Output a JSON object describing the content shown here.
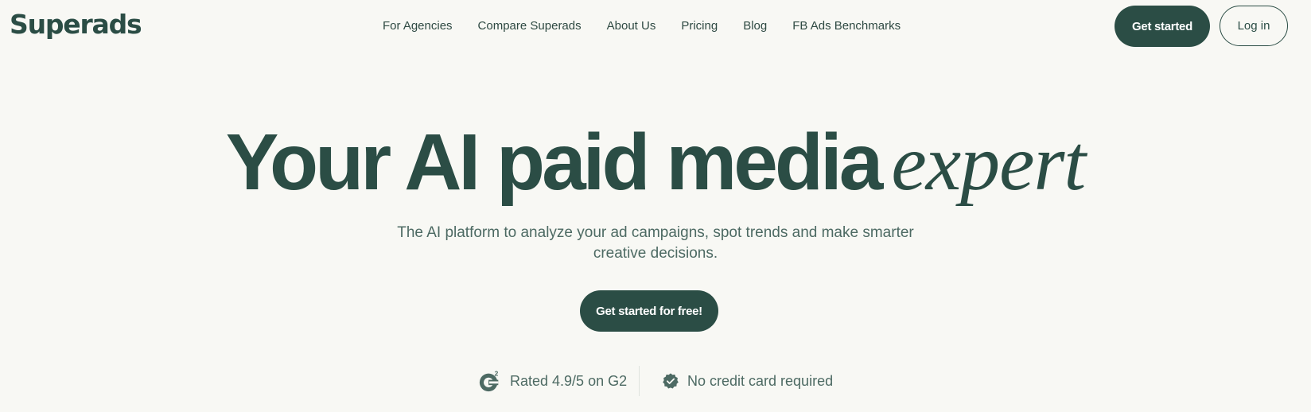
{
  "header": {
    "logo_text": "Superads",
    "nav": [
      {
        "label": "For Agencies"
      },
      {
        "label": "Compare Superads"
      },
      {
        "label": "About Us"
      },
      {
        "label": "Pricing"
      },
      {
        "label": "Blog"
      },
      {
        "label": "FB Ads Benchmarks"
      }
    ],
    "get_started_label": "Get started",
    "login_label": "Log in"
  },
  "hero": {
    "title_main": "Your AI paid media",
    "title_italic": "expert",
    "subtitle": "The AI platform to analyze your ad campaigns, spot trends and make smarter creative decisions.",
    "cta_label": "Get started for free!"
  },
  "trust": {
    "g2_text": "Rated 4.9/5 on G2",
    "no_card_text": "No credit card required"
  },
  "colors": {
    "background": "#f8f8f4",
    "brand": "#2b4d45",
    "text_muted": "#4d6a63"
  },
  "icons": {
    "g2": "g2-logo-icon",
    "verified": "verified-check-icon"
  }
}
